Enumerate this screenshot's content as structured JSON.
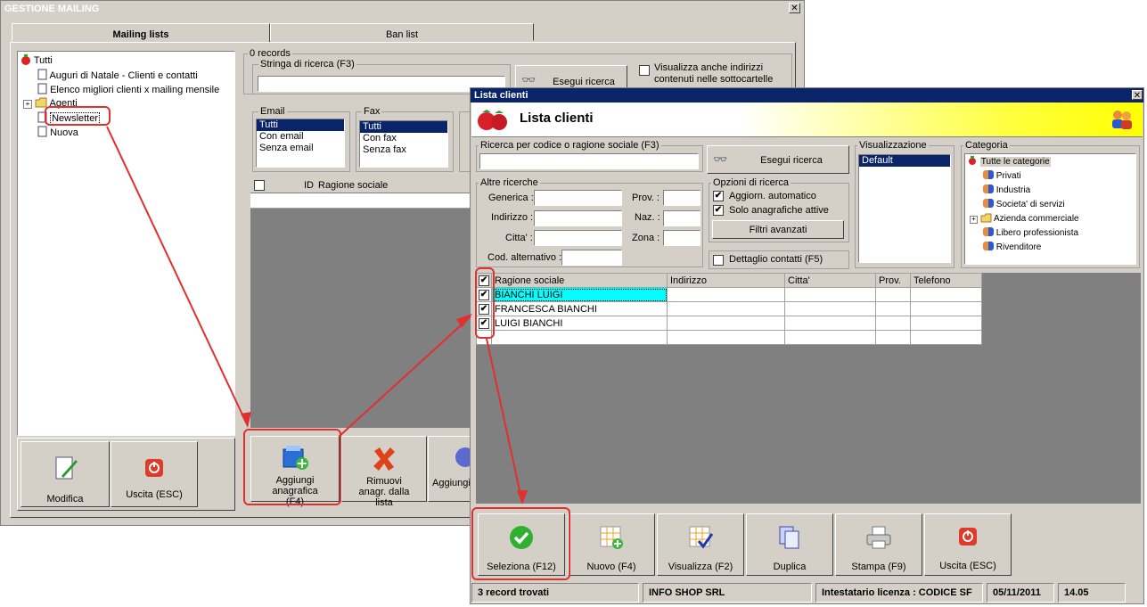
{
  "gm": {
    "title": "GESTIONE MAILING",
    "tabs": [
      "Mailing lists",
      "Ban list"
    ],
    "tree": {
      "root": "Tutti",
      "items": [
        "Auguri di Natale - Clienti e contatti",
        "Elenco migliori clienti x mailing mensile",
        "Agenti",
        "Newsletter",
        "Nuova"
      ]
    },
    "records": "0 records",
    "search_label": "Stringa di ricerca (F3)",
    "search_btn": "Esegui ricerca",
    "subfolders": "Visualizza anche indirizzi contenuti nelle sottocartelle",
    "email": {
      "label": "Email",
      "options": [
        "Tutti",
        "Con email",
        "Senza email"
      ]
    },
    "fax": {
      "label": "Fax",
      "options": [
        "Tutti",
        "Con fax",
        "Senza fax"
      ]
    },
    "grid_cols": [
      "ID",
      "Ragione sociale"
    ],
    "buttons": {
      "modifica": "Modifica",
      "uscita": "Uscita (ESC)",
      "aggiungi": "Aggiungi anagrafica (F4)",
      "rimuovi": "Rimuovi anagr. dalla lista",
      "aggiungi_em": "Aggiungi em"
    }
  },
  "lc": {
    "title": "Lista clienti",
    "header": "Lista clienti",
    "search_label": "Ricerca per codice o ragione sociale (F3)",
    "search_btn": "Esegui ricerca",
    "altre": {
      "label": "Altre ricerche",
      "generica": "Generica :",
      "indirizzo": "Indirizzo :",
      "citta": "Citta' :",
      "cod": "Cod. alternativo :",
      "prov": "Prov. :",
      "naz": "Naz. :",
      "zona": "Zona :"
    },
    "opzioni": {
      "label": "Opzioni di ricerca",
      "aggiorn": "Aggiorn. automatico",
      "solo": "Solo anagrafiche attive",
      "filtri": "Filtri avanzati"
    },
    "dettaglio": "Dettaglio contatti (F5)",
    "visual": {
      "label": "Visualizzazione",
      "selected": "Default"
    },
    "categoria": {
      "label": "Categoria",
      "root": "Tutte le categorie",
      "items": [
        "Privati",
        "Industria",
        "Societa' di servizi",
        "Azienda commerciale",
        "Libero professionista",
        "Rivenditore"
      ]
    },
    "grid": {
      "cols": [
        "Ragione sociale",
        "Indirizzo",
        "Citta'",
        "Prov.",
        "Telefono"
      ],
      "rows": [
        "BIANCHI LUIGI",
        "FRANCESCA BIANCHI",
        "LUIGI BIANCHI"
      ]
    },
    "buttons": {
      "seleziona": "Seleziona (F12)",
      "nuovo": "Nuovo (F4)",
      "visualizza": "Visualizza (F2)",
      "duplica": "Duplica",
      "stampa": "Stampa (F9)",
      "uscita": "Uscita (ESC)"
    },
    "status": {
      "found": "3 record trovati",
      "company": "INFO SHOP SRL",
      "license": "Intestatario licenza : CODICE SF",
      "date": "05/11/2011",
      "time": "14.05"
    }
  },
  "colors": {
    "selection": "#0a246a",
    "highlight_row": "#00ffff",
    "annotation": "#e03030",
    "header_gradient": "#ffff00"
  }
}
